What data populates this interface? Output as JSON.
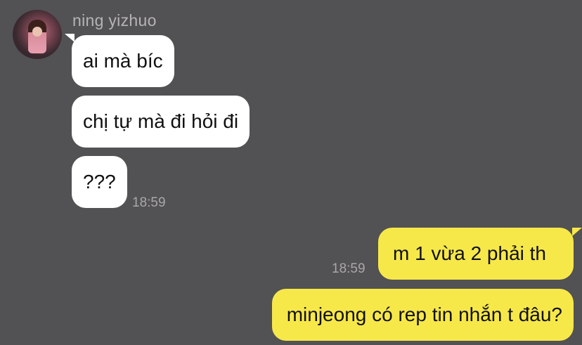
{
  "chat": {
    "contact_name": "ning yizhuo",
    "incoming": [
      {
        "text": "ai mà bíc"
      },
      {
        "text": "chị tự mà đi hỏi đi"
      },
      {
        "text": "???"
      }
    ],
    "incoming_time": "18:59",
    "outgoing": [
      {
        "text": "m 1 vừa 2 phải th"
      },
      {
        "text": "minjeong có rep tin nhắn t đâu?"
      }
    ],
    "outgoing_time": "18:59"
  },
  "colors": {
    "background": "#525153",
    "incoming_bubble": "#ffffff",
    "outgoing_bubble": "#f7e84a"
  }
}
